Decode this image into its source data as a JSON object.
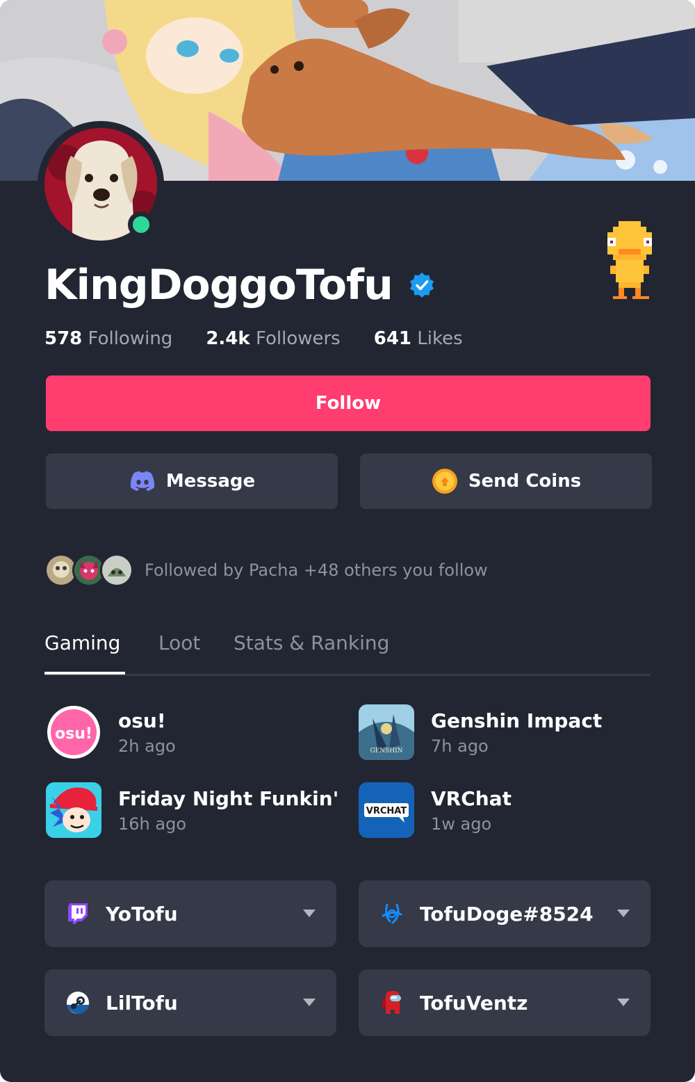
{
  "profile": {
    "username": "KingDoggoTofu",
    "verified": true,
    "online": true
  },
  "stats": [
    {
      "value": "578",
      "label": "Following"
    },
    {
      "value": "2.4k",
      "label": "Followers"
    },
    {
      "value": "641",
      "label": "Likes"
    }
  ],
  "actions": {
    "follow_label": "Follow",
    "message_label": "Message",
    "send_coins_label": "Send Coins"
  },
  "followed_by": {
    "text": "Followed by Pacha +48 others you follow"
  },
  "tabs": [
    {
      "label": "Gaming",
      "active": true
    },
    {
      "label": "Loot",
      "active": false
    },
    {
      "label": "Stats & Ranking",
      "active": false
    }
  ],
  "games": [
    {
      "name": "osu!",
      "time": "2h ago",
      "icon": "osu-icon",
      "icon_text": "osu!"
    },
    {
      "name": "Genshin Impact",
      "time": "7h ago",
      "icon": "genshin-impact-icon",
      "icon_text": "GENSHIN"
    },
    {
      "name": "Friday Night Funkin'",
      "time": "16h ago",
      "icon": "friday-night-funkin-icon"
    },
    {
      "name": "VRChat",
      "time": "1w ago",
      "icon": "vrchat-icon",
      "icon_text": "VRCHAT"
    }
  ],
  "accounts": [
    {
      "platform": "twitch",
      "name": "YoTofu",
      "icon": "twitch-icon"
    },
    {
      "platform": "battlenet",
      "name": "TofuDoge#8524",
      "icon": "battlenet-icon"
    },
    {
      "platform": "steam",
      "name": "LilTofu",
      "icon": "steam-icon"
    },
    {
      "platform": "among-us",
      "name": "TofuVentz",
      "icon": "among-us-icon"
    }
  ],
  "colors": {
    "background": "#222632",
    "surface": "#353948",
    "accent": "#ff3d6f",
    "online": "#2ed89a",
    "verified": "#1d9bf0",
    "muted_text": "#a4a7b4"
  }
}
